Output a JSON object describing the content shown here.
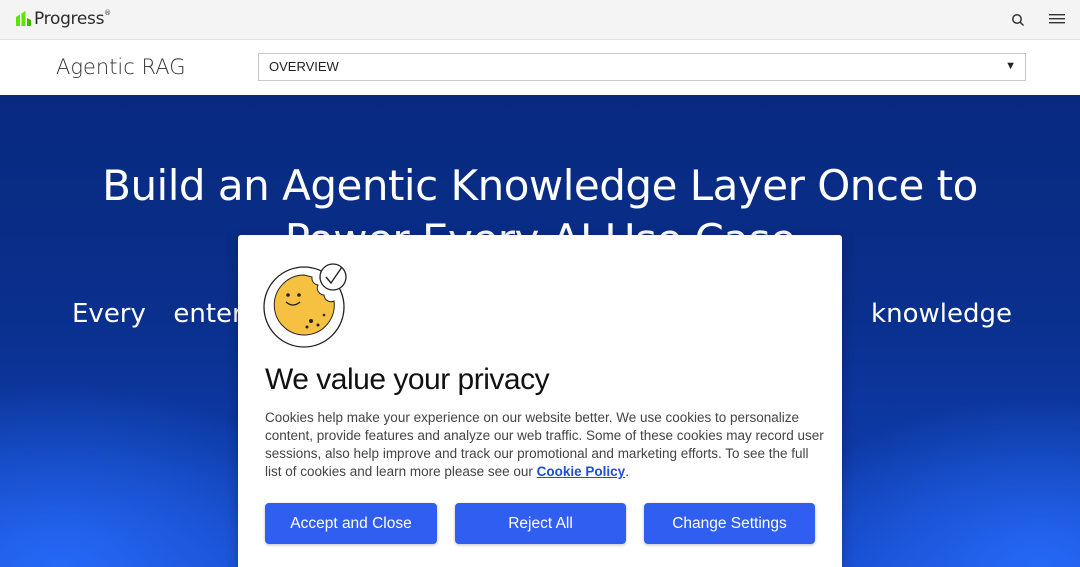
{
  "header": {
    "logo_text": "Progress",
    "logo_reg": "®",
    "icons": [
      "search-icon",
      "hamburger-menu-icon"
    ]
  },
  "subnav": {
    "title": "Agentic RAG",
    "select_value": "OVERVIEW"
  },
  "hero": {
    "heading_line1": "Build an Agentic Knowledge Layer Once to",
    "heading_line2": "Power Every AI Use Case",
    "subtext": "Every enterprise needs a single, governed agentic knowledge"
  },
  "cookie_modal": {
    "title": "We value your privacy",
    "body": "Cookies help make your experience on our website better. We use cookies to personalize content, provide features and analyze our web traffic. Some of these cookies may record user sessions, also help improve and track our promotional and marketing efforts. To see the full list of cookies and learn more please see our ",
    "link_text": "Cookie Policy",
    "body_end": ".",
    "accept_label": "Accept and Close",
    "reject_label": "Reject All",
    "settings_label": "Change Settings"
  },
  "colors": {
    "brand_green": "#5ce500",
    "hero_blue": "#0a2f8c",
    "button_blue": "#2f5ef0",
    "cookie_yellow": "#f6c141"
  }
}
